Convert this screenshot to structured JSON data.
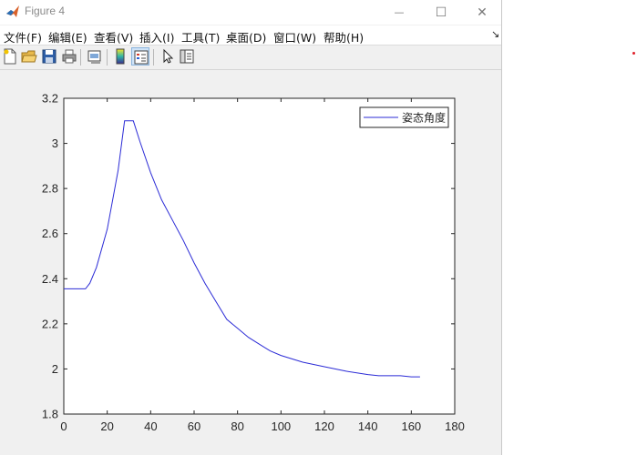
{
  "window": {
    "title": "Figure 4",
    "controls": {
      "minimize": "—",
      "maximize": "☐",
      "close": "✕"
    }
  },
  "menu": {
    "items": [
      "文件(F)",
      "编辑(E)",
      "查看(V)",
      "插入(I)",
      "工具(T)",
      "桌面(D)",
      "窗口(W)",
      "帮助(H)"
    ],
    "dock_arrow": "↘"
  },
  "toolbar": {
    "buttons": [
      {
        "icon": "new-figure-icon"
      },
      {
        "icon": "open-folder-icon"
      },
      {
        "icon": "save-icon"
      },
      {
        "icon": "print-icon"
      },
      {
        "icon": "link-plot-icon"
      },
      {
        "icon": "insert-colorbar-icon"
      },
      {
        "icon": "insert-legend-icon",
        "active": true
      },
      {
        "icon": "edit-plot-icon"
      },
      {
        "icon": "property-inspector-icon"
      }
    ]
  },
  "colors": {
    "line": "#2b2bd6",
    "axes": "#262626",
    "background": "#f0f0f0"
  },
  "chart_data": {
    "type": "line",
    "xlim": [
      0,
      180
    ],
    "ylim": [
      1.8,
      3.2
    ],
    "xticks": [
      0,
      20,
      40,
      60,
      80,
      100,
      120,
      140,
      160,
      180
    ],
    "yticks": [
      1.8,
      2.0,
      2.2,
      2.4,
      2.6,
      2.8,
      3.0,
      3.2
    ],
    "xtick_labels": [
      "0",
      "20",
      "40",
      "60",
      "80",
      "100",
      "120",
      "140",
      "160",
      "180"
    ],
    "ytick_labels": [
      "1.8",
      "2",
      "2.2",
      "2.4",
      "2.6",
      "2.8",
      "3",
      "3.2"
    ],
    "grid": false,
    "legend_position": "top-right",
    "series": [
      {
        "name": "姿态角度",
        "x": [
          0,
          5,
          10,
          12,
          15,
          20,
          25,
          28,
          30,
          32,
          35,
          40,
          45,
          50,
          55,
          60,
          65,
          70,
          75,
          80,
          85,
          90,
          95,
          100,
          110,
          120,
          130,
          140,
          145,
          150,
          155,
          160,
          164
        ],
        "y": [
          2.355,
          2.355,
          2.355,
          2.38,
          2.45,
          2.62,
          2.88,
          3.1,
          3.1,
          3.1,
          3.01,
          2.87,
          2.75,
          2.66,
          2.57,
          2.47,
          2.38,
          2.3,
          2.22,
          2.18,
          2.14,
          2.11,
          2.08,
          2.06,
          2.03,
          2.01,
          1.99,
          1.975,
          1.97,
          1.97,
          1.97,
          1.965,
          1.965
        ]
      }
    ]
  }
}
